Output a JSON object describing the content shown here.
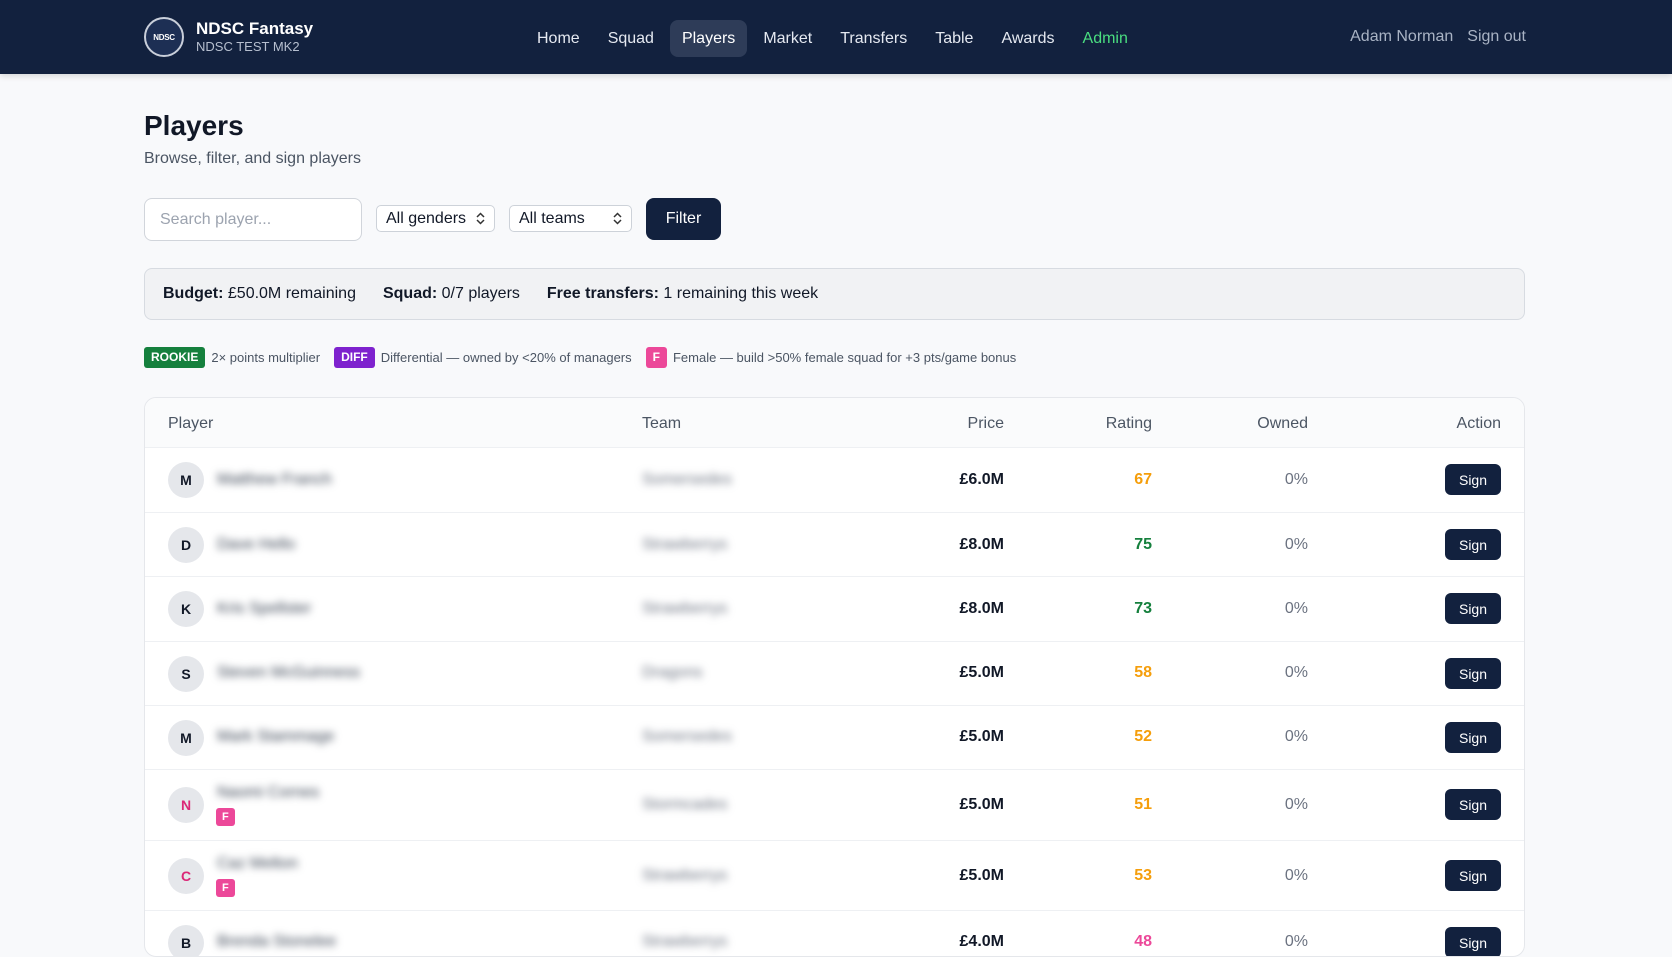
{
  "nav": {
    "brand_logo_text": "NDSC",
    "brand_title": "NDSC Fantasy",
    "brand_subtitle": "NDSC TEST MK2",
    "items": [
      {
        "label": "Home"
      },
      {
        "label": "Squad"
      },
      {
        "label": "Players",
        "active": true
      },
      {
        "label": "Market"
      },
      {
        "label": "Transfers"
      },
      {
        "label": "Table"
      },
      {
        "label": "Awards"
      },
      {
        "label": "Admin",
        "color": "#4ade80"
      }
    ],
    "user_name": "Adam Norman",
    "sign_out": "Sign out"
  },
  "page": {
    "title": "Players",
    "subtitle": "Browse, filter, and sign players"
  },
  "filters": {
    "search_placeholder": "Search player...",
    "gender_value": "All genders",
    "team_value": "All teams",
    "filter_button": "Filter"
  },
  "budget": {
    "budget_label": "Budget:",
    "budget_value": "£50.0M remaining",
    "squad_label": "Squad:",
    "squad_value": "0/7 players",
    "transfers_label": "Free transfers:",
    "transfers_value": "1 remaining this week"
  },
  "legend": {
    "rookie_badge": "ROOKIE",
    "rookie_text": "2× points multiplier",
    "diff_badge": "DIFF",
    "diff_text": "Differential — owned by <20% of managers",
    "female_badge": "F",
    "female_text": "Female — build >50% female squad for +3 pts/game bonus"
  },
  "table": {
    "headers": {
      "player": "Player",
      "team": "Team",
      "price": "Price",
      "rating": "Rating",
      "owned": "Owned",
      "action": "Action"
    },
    "female_badge": "F",
    "sign_label": "Sign",
    "rows": [
      {
        "initial": "M",
        "name": "Matthew Franch",
        "team": "Somersedes",
        "price": "£6.0M",
        "rating": "67",
        "rating_color": "#f59e0b",
        "owned": "0%",
        "female": false
      },
      {
        "initial": "D",
        "name": "Dave Hello",
        "team": "Strawberrys",
        "price": "£8.0M",
        "rating": "75",
        "rating_color": "#15803d",
        "owned": "0%",
        "female": false
      },
      {
        "initial": "K",
        "name": "Kris Spellster",
        "team": "Strawberrys",
        "price": "£8.0M",
        "rating": "73",
        "rating_color": "#15803d",
        "owned": "0%",
        "female": false
      },
      {
        "initial": "S",
        "name": "Steven McGuinness",
        "team": "Dragons",
        "price": "£5.0M",
        "rating": "58",
        "rating_color": "#f59e0b",
        "owned": "0%",
        "female": false
      },
      {
        "initial": "M",
        "name": "Mark Stammage",
        "team": "Somersedes",
        "price": "£5.0M",
        "rating": "52",
        "rating_color": "#f59e0b",
        "owned": "0%",
        "female": false
      },
      {
        "initial": "N",
        "name": "Naomi Cornes",
        "team": "Stormcades",
        "price": "£5.0M",
        "rating": "51",
        "rating_color": "#f59e0b",
        "owned": "0%",
        "female": true
      },
      {
        "initial": "C",
        "name": "Caz Melton",
        "team": "Strawberrys",
        "price": "£5.0M",
        "rating": "53",
        "rating_color": "#f59e0b",
        "owned": "0%",
        "female": true
      },
      {
        "initial": "B",
        "name": "Brenda Stonelee",
        "team": "Strawberrys",
        "price": "£4.0M",
        "rating": "48",
        "rating_color": "#ec4899",
        "owned": "0%",
        "female": false
      }
    ]
  }
}
